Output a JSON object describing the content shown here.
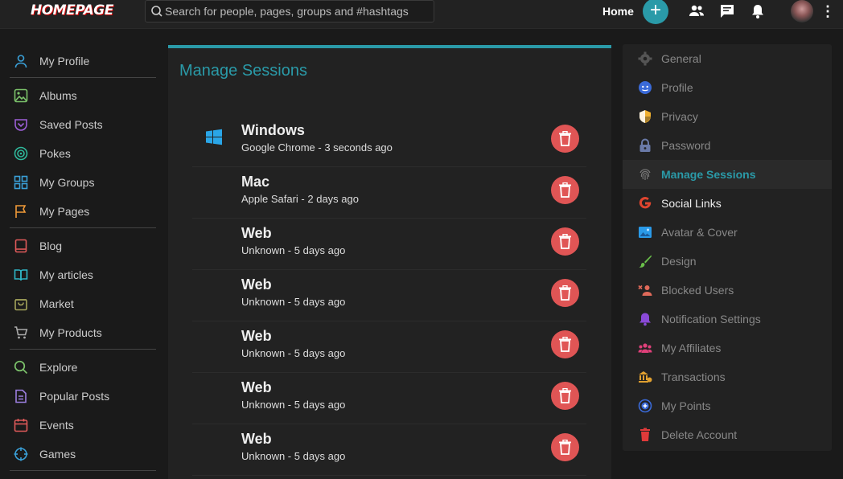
{
  "app": {
    "logo_text": "HOMEPAGE"
  },
  "search": {
    "placeholder": "Search for people, pages, groups and #hashtags"
  },
  "topbar": {
    "home_label": "Home",
    "plus_label": "+",
    "kebab": "⋮"
  },
  "left_nav": {
    "items": [
      {
        "label": "My Profile",
        "icon": "user-icon",
        "color": "#3aa0d8"
      },
      {
        "label": "Albums",
        "icon": "image-icon",
        "color": "#7cc36b"
      },
      {
        "label": "Saved Posts",
        "icon": "bookmark-icon",
        "color": "#9c5fd8"
      },
      {
        "label": "Pokes",
        "icon": "target-icon",
        "color": "#2fb89b"
      },
      {
        "label": "My Groups",
        "icon": "grid-icon",
        "color": "#3aa0d8"
      },
      {
        "label": "My Pages",
        "icon": "flag-icon",
        "color": "#f09a38"
      },
      {
        "label": "Blog",
        "icon": "book-icon",
        "color": "#e05a5a"
      },
      {
        "label": "My articles",
        "icon": "open-book-icon",
        "color": "#2fb8c8"
      },
      {
        "label": "Market",
        "icon": "bag-icon",
        "color": "#a4a35a"
      },
      {
        "label": "My Products",
        "icon": "cart-icon",
        "color": "#aaaaaa"
      },
      {
        "label": "Explore",
        "icon": "search-icon",
        "color": "#7cc36b"
      },
      {
        "label": "Popular Posts",
        "icon": "document-icon",
        "color": "#9c7fe0"
      },
      {
        "label": "Events",
        "icon": "calendar-icon",
        "color": "#e05a5a"
      },
      {
        "label": "Games",
        "icon": "crosshair-icon",
        "color": "#3aa0d8"
      }
    ]
  },
  "main": {
    "title": "Manage Sessions",
    "sessions": [
      {
        "name": "Windows",
        "info": "Google Chrome - 3 seconds ago",
        "icon": "windows-icon"
      },
      {
        "name": "Mac",
        "info": "Apple Safari - 2 days ago",
        "icon": ""
      },
      {
        "name": "Web",
        "info": "Unknown - 5 days ago",
        "icon": ""
      },
      {
        "name": "Web",
        "info": "Unknown - 5 days ago",
        "icon": ""
      },
      {
        "name": "Web",
        "info": "Unknown - 5 days ago",
        "icon": ""
      },
      {
        "name": "Web",
        "info": "Unknown - 5 days ago",
        "icon": ""
      },
      {
        "name": "Web",
        "info": "Unknown - 5 days ago",
        "icon": ""
      }
    ]
  },
  "settings_nav": {
    "items": [
      {
        "label": "General",
        "icon": "gear-icon",
        "color": "#555555"
      },
      {
        "label": "Profile",
        "icon": "face-icon",
        "color": "#3a6ad8"
      },
      {
        "label": "Privacy",
        "icon": "shield-icon",
        "color": "#f0b030"
      },
      {
        "label": "Password",
        "icon": "lock-icon",
        "color": "#6a7aa8"
      },
      {
        "label": "Manage Sessions",
        "icon": "fingerprint-icon",
        "color": "#777777",
        "active": true
      },
      {
        "label": "Social Links",
        "icon": "google-icon",
        "color": "#e0452f",
        "bright": true
      },
      {
        "label": "Avatar & Cover",
        "icon": "picture-icon",
        "color": "#2a9ae8"
      },
      {
        "label": "Design",
        "icon": "brush-icon",
        "color": "#6abf4a"
      },
      {
        "label": "Blocked Users",
        "icon": "user-block-icon",
        "color": "#e06a5a"
      },
      {
        "label": "Notification Settings",
        "icon": "bell-icon",
        "color": "#8a4ad8"
      },
      {
        "label": "My Affiliates",
        "icon": "group-icon",
        "color": "#e0407a"
      },
      {
        "label": "Transactions",
        "icon": "bank-icon",
        "color": "#e0a030"
      },
      {
        "label": "My Points",
        "icon": "plus-circle-icon",
        "color": "#3a6ad8"
      },
      {
        "label": "Delete Account",
        "icon": "trash-icon",
        "color": "#e03a3a"
      }
    ]
  }
}
